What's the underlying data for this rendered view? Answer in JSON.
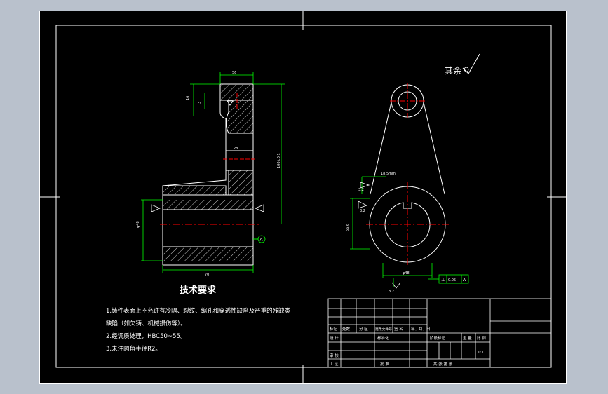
{
  "drawing": {
    "note_top_right": "其余",
    "tech_title": "技术要求",
    "tech_lines": [
      "1.铸件表面上不允许有冷隔、裂纹、缩孔和穿透性缺陷及严重的残缺类",
      "缺陷（如欠铸、机械损伤等）。",
      "2.经调质处理，HBC50~55。",
      "3.未注圆角半径R2。"
    ],
    "datum_label": "A",
    "rough_symbol_label": "3.2",
    "perp_frame": [
      "⊥",
      "0.05",
      "A"
    ]
  },
  "title_block": {
    "row_headers": [
      "标记",
      "处数",
      "分 区",
      "更改文件号",
      "签 名",
      "年、月、日"
    ],
    "design": "设 计",
    "standard": "标准化",
    "review": "审 核",
    "process": "工 艺",
    "approve": "批 准",
    "stage_mark": "阶段标记",
    "weight": "重 量",
    "scale": "比 例",
    "scale_value": "1:1",
    "sheet": "共    张  第    张"
  },
  "colors": {
    "background": "#000000",
    "line": "#ffffff",
    "center": "#ff0000",
    "dimension": "#00ff00",
    "outer": "#b9c1cc"
  }
}
